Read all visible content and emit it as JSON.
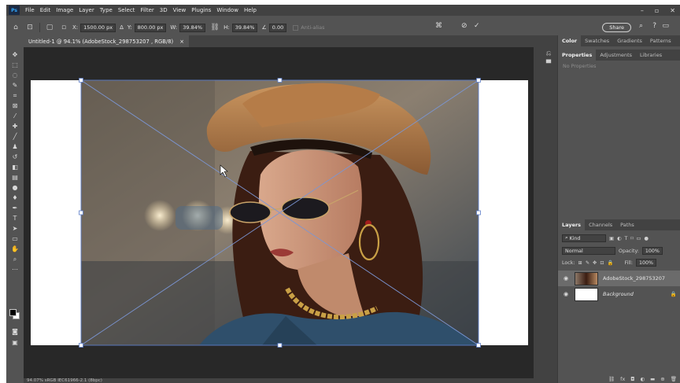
{
  "menu": {
    "logo": "Ps",
    "items": [
      "File",
      "Edit",
      "Image",
      "Layer",
      "Type",
      "Select",
      "Filter",
      "3D",
      "View",
      "Plugins",
      "Window",
      "Help"
    ],
    "window_controls": [
      "–",
      "▫",
      "✕"
    ]
  },
  "options_bar": {
    "x_label": "X:",
    "x_value": "1500.00 px",
    "y_label": "Y:",
    "y_value": "800.00 px",
    "w_label": "W:",
    "w_value": "39.84%",
    "h_label": "H:",
    "h_value": "39.84%",
    "angle_value": "0.00",
    "anti_alias_label": "Anti-alias",
    "share_label": "Share"
  },
  "document": {
    "tab_title": "Untitled-1 @ 94.1% (AdobeStock_298753207 , RGB/8)",
    "close": "×",
    "status_text": "94.07%    sRGB IEC61966-2.1 (8bpc)"
  },
  "panels": {
    "top_tabs": [
      "Color",
      "Swatches",
      "Gradients",
      "Patterns"
    ],
    "mid_tabs": [
      "Properties",
      "Adjustments",
      "Libraries"
    ],
    "no_properties": "No Properties",
    "layer_tabs": [
      "Layers",
      "Channels",
      "Paths"
    ],
    "kind_placeholder": "Kind",
    "blend_mode": "Normal",
    "opacity_label": "Opacity:",
    "opacity_value": "100%",
    "lock_label": "Lock:",
    "fill_label": "Fill:",
    "fill_value": "100%",
    "layers": [
      {
        "name": "AdobeStock_298753207"
      },
      {
        "name": "Background"
      }
    ]
  },
  "colors": {
    "app_bg": "#535353",
    "canvas_bg": "#282828",
    "transform_line": "#5d7ec9"
  }
}
